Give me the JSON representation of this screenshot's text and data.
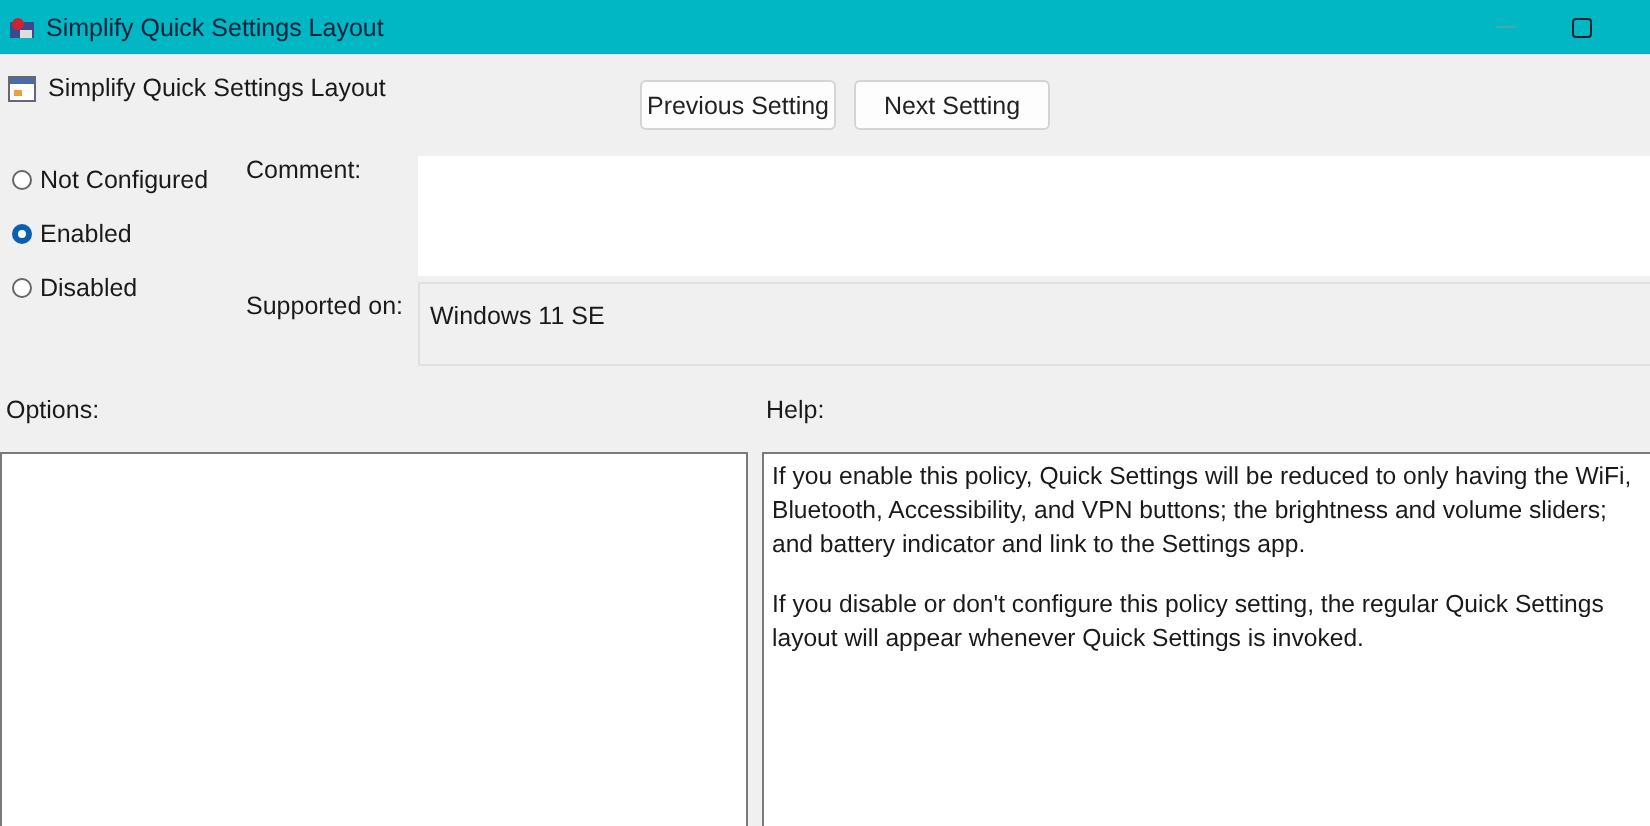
{
  "window": {
    "title": "Simplify Quick Settings Layout"
  },
  "heading": "Simplify Quick Settings Layout",
  "buttons": [
    "Previous Setting",
    "Next Setting"
  ],
  "states": [
    {
      "label": "Not Configured",
      "selected": false
    },
    {
      "label": "Enabled",
      "selected": true
    },
    {
      "label": "Disabled",
      "selected": false
    }
  ],
  "comment": {
    "label": "Comment:"
  },
  "supported_on": {
    "label": "Supported on:",
    "value": "Windows 11 SE"
  },
  "options": {
    "label": "Options:"
  },
  "help": {
    "label": "Help:",
    "paragraphs": [
      "If you enable this policy, Quick Settings will be reduced to only having the WiFi, Bluetooth, Accessibility, and VPN buttons; the brightness and volume sliders; and battery indicator and link to the Settings app.",
      "If you disable or don't configure this policy setting, the regular Quick Settings layout will appear whenever Quick Settings is invoked."
    ]
  }
}
